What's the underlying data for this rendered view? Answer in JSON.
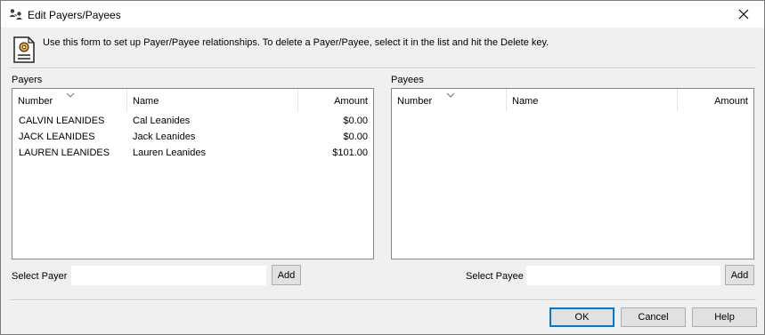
{
  "window": {
    "title": "Edit Payers/Payees",
    "icon": "people-icon",
    "close_icon": "close-icon"
  },
  "info": {
    "icon": "form-settings-icon",
    "text": "Use this form to set up Payer/Payee relationships.  To delete a Payer/Payee, select it in the list and hit the Delete key."
  },
  "payers": {
    "label": "Payers",
    "columns": [
      "Number",
      "Name",
      "Amount"
    ],
    "rows": [
      {
        "number": "CALVIN LEANIDES",
        "name": "Cal Leanides",
        "amount": "$0.00"
      },
      {
        "number": "JACK LEANIDES",
        "name": "Jack Leanides",
        "amount": "$0.00"
      },
      {
        "number": "LAUREN LEANIDES",
        "name": "Lauren Leanides",
        "amount": "$101.00"
      }
    ],
    "select_label": "Select Payer",
    "select_value": "",
    "add_label": "Add"
  },
  "payees": {
    "label": "Payees",
    "columns": [
      "Number",
      "Name",
      "Amount"
    ],
    "rows": [],
    "select_label": "Select Payee",
    "select_value": "",
    "add_label": "Add"
  },
  "buttons": {
    "ok": "OK",
    "cancel": "Cancel",
    "help": "Help"
  },
  "colors": {
    "default_button_border": "#0078d7",
    "dialog_background": "#f0f0f0"
  }
}
